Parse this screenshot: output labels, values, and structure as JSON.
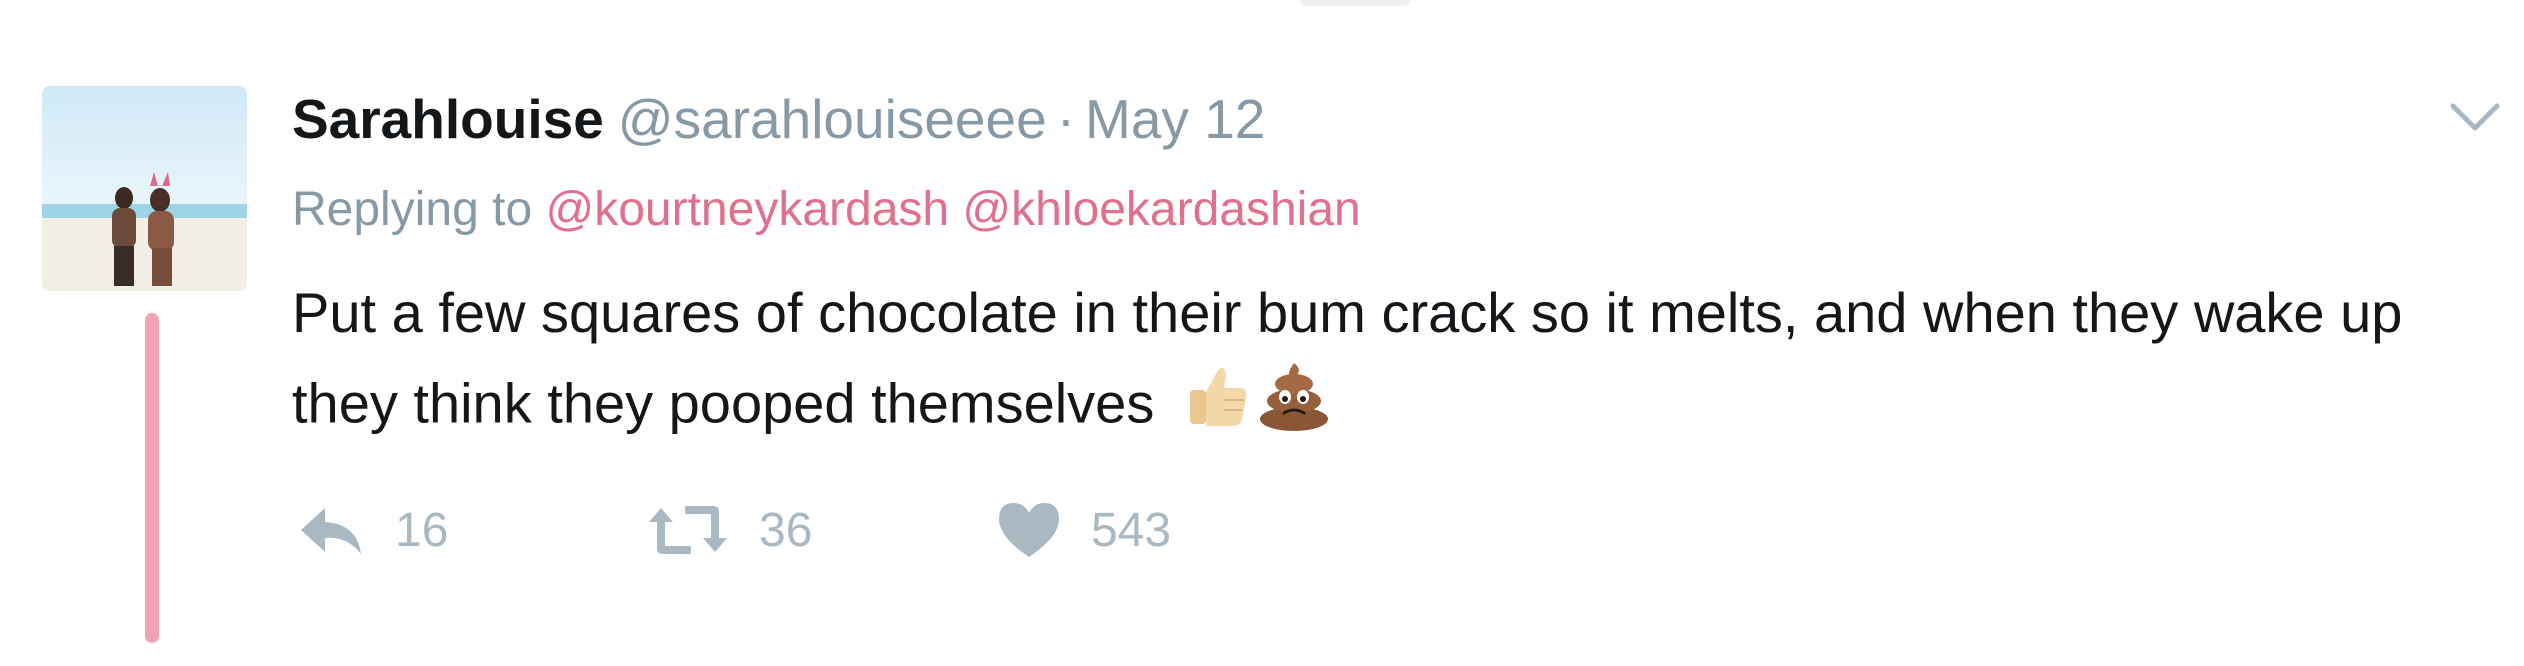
{
  "tweet": {
    "display_name": "Sarahlouise",
    "handle": "@sarahlouiseeee",
    "separator": "·",
    "date": "May 12",
    "replying_to": {
      "prefix": "Replying to",
      "mentions": [
        "@kourtneykardash",
        "@khloekardashian"
      ]
    },
    "text": "Put a few squares of chocolate in their bum crack so it melts, and when they wake up they think they pooped themselves",
    "emojis": [
      "thumbs-up-icon",
      "pile-of-poo-icon"
    ],
    "actions": {
      "reply_count": "16",
      "retweet_count": "36",
      "like_count": "543"
    }
  },
  "colors": {
    "mention": "#e0708e",
    "thread_line": "#f2a3b7",
    "muted": "#8899a6",
    "action_icon": "#aab8c2"
  }
}
